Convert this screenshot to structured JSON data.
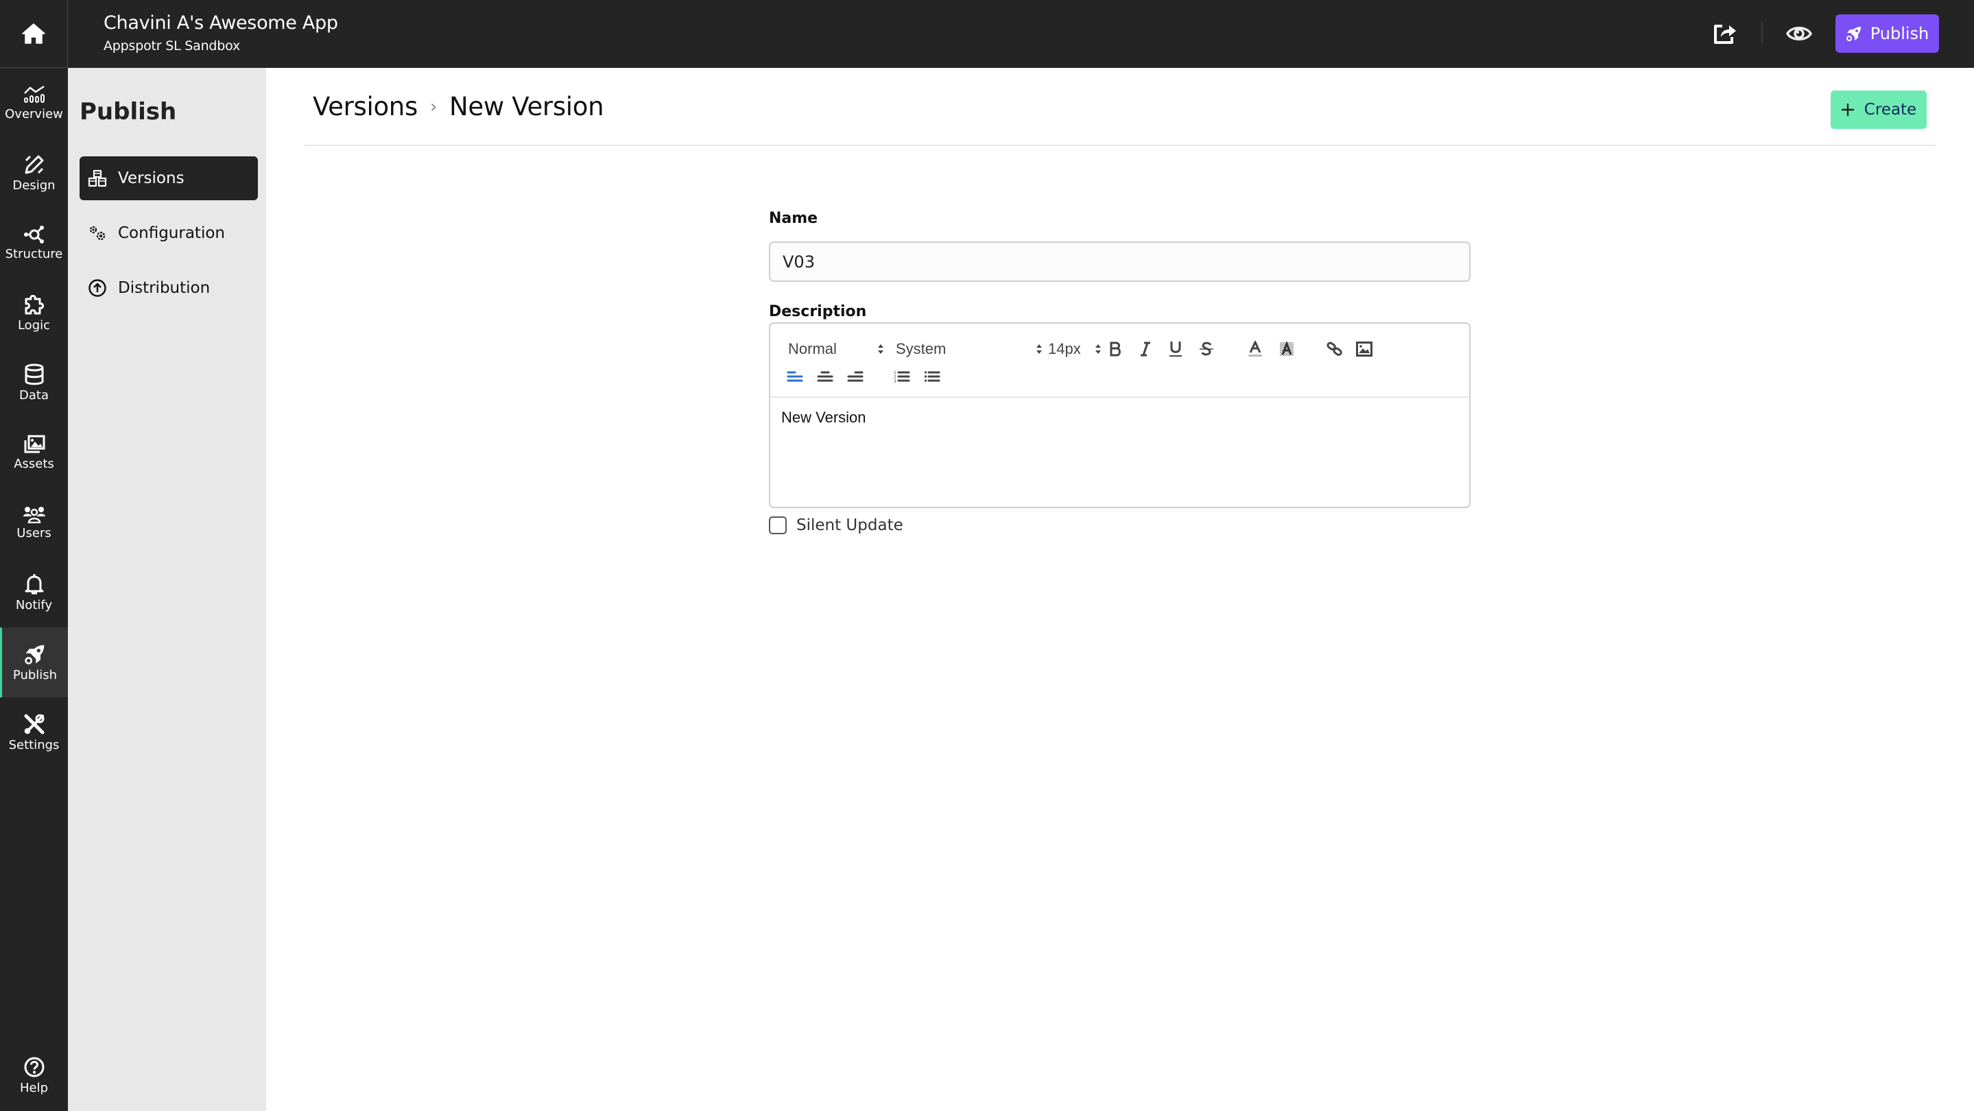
{
  "header": {
    "app_title": "Chavini A's Awesome App",
    "app_subtitle": "Appspotr SL Sandbox",
    "publish_label": "Publish",
    "icons": {
      "home": "home-icon",
      "share": "share-icon",
      "preview": "eye-icon",
      "publish": "rocket-icon"
    }
  },
  "rail": {
    "items": [
      {
        "label": "Overview",
        "icon": "chart-line-icon"
      },
      {
        "label": "Design",
        "icon": "pencil-ruler-icon"
      },
      {
        "label": "Structure",
        "icon": "nodes-icon"
      },
      {
        "label": "Logic",
        "icon": "puzzle-icon"
      },
      {
        "label": "Data",
        "icon": "database-icon"
      },
      {
        "label": "Assets",
        "icon": "images-icon"
      },
      {
        "label": "Users",
        "icon": "users-icon"
      },
      {
        "label": "Notify",
        "icon": "bell-icon"
      },
      {
        "label": "Publish",
        "icon": "rocket-icon",
        "active": true
      },
      {
        "label": "Settings",
        "icon": "tools-icon"
      }
    ],
    "help_label": "Help"
  },
  "subnav": {
    "title": "Publish",
    "items": [
      {
        "label": "Versions",
        "icon": "cubes-icon",
        "active": true
      },
      {
        "label": "Configuration",
        "icon": "cogs-icon"
      },
      {
        "label": "Distribution",
        "icon": "arrow-circle-up-icon"
      }
    ]
  },
  "main": {
    "breadcrumb": {
      "parent": "Versions",
      "separator": "›",
      "current": "New Version"
    },
    "create_label": "Create",
    "form": {
      "name_label": "Name",
      "name_value": "V03",
      "description_label": "Description",
      "toolbar": {
        "heading_select": "Normal",
        "font_select": "System",
        "size_select": "14px",
        "buttons": [
          "bold",
          "italic",
          "underline",
          "strike",
          "text-color",
          "background-color",
          "link",
          "image",
          "align-left",
          "align-center",
          "align-right",
          "ordered-list",
          "bullet-list"
        ],
        "active_align": "left",
        "accent_color": "#2b6fd6"
      },
      "description_value": "New Version",
      "silent_update_label": "Silent Update",
      "silent_update_checked": false
    }
  },
  "colors": {
    "dark": "#242424",
    "publish_accent": "#7b4ff5",
    "create_accent": "#6eebb3",
    "active_rail_border": "#3fd39a",
    "subnav_bg": "#e8e8e8"
  }
}
